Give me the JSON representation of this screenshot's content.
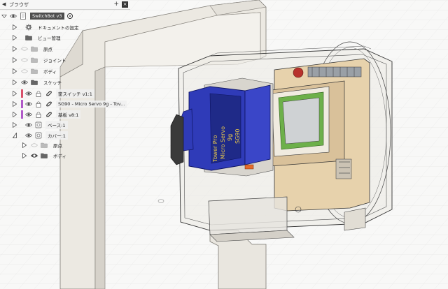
{
  "browser": {
    "title": "ブラウザ",
    "add_symbol": "+",
    "close_symbol": "×",
    "root": {
      "label": "SwitchBot v3"
    },
    "items": [
      {
        "label": "ドキュメントの設定",
        "icon": "gear-icon"
      },
      {
        "label": "ビュー管理",
        "icon": "folder-icon"
      },
      {
        "label": "原点",
        "icon": "folder-icon"
      },
      {
        "label": "ジョイント",
        "icon": "folder-icon"
      },
      {
        "label": "ボディ",
        "icon": "folder-icon"
      },
      {
        "label": "スケッチ",
        "icon": "folder-icon"
      },
      {
        "label": "筐スイッチ v1:1",
        "icon": "link-icon",
        "color": "#d9506a"
      },
      {
        "label": "SG90 - Micro Servo 9g - Tov...",
        "icon": "link-icon",
        "color": "#b058c8"
      },
      {
        "label": "基板 v8:1",
        "icon": "link-icon",
        "color": "#b058c8"
      },
      {
        "label": "ベース:1",
        "icon": "component-icon"
      },
      {
        "label": "カバー:1",
        "icon": "component-icon"
      },
      {
        "label": "原点",
        "icon": "folder-icon"
      },
      {
        "label": "ボディ",
        "icon": "folder-icon"
      }
    ]
  },
  "model": {
    "servo_text_1": "Tower Pro",
    "servo_text_2": "Micro Servo",
    "servo_text_3": "9g",
    "servo_text_4": "SG90"
  },
  "colors": {
    "servo": "#2f3bb8",
    "board": "#e6cfa8",
    "pcb_green": "#6db04a",
    "frame": "#ece9e2"
  }
}
